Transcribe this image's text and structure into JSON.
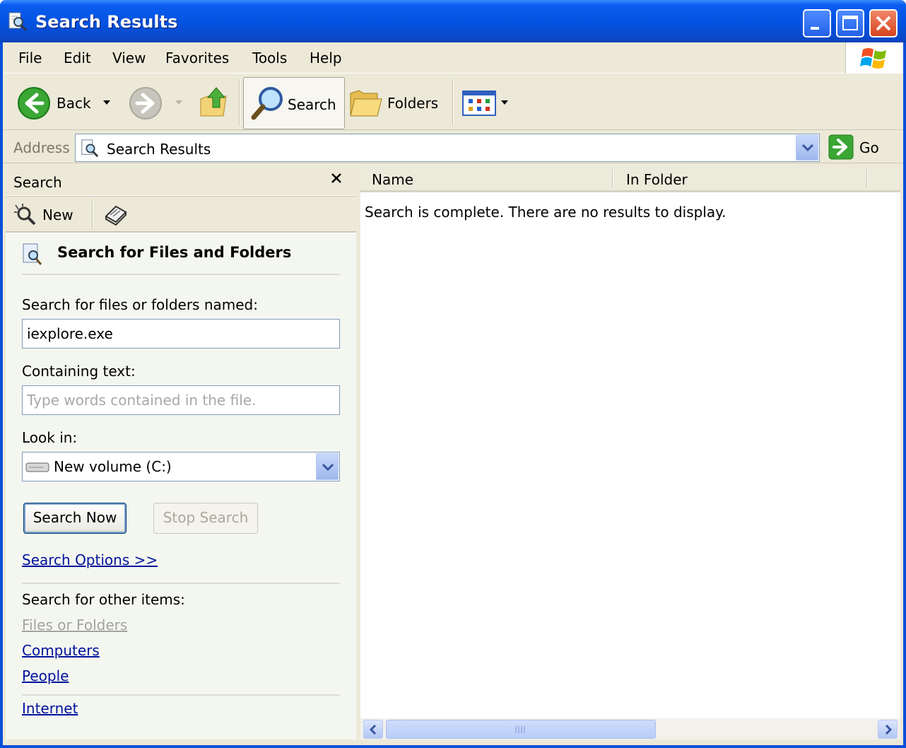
{
  "window": {
    "title": "Search Results"
  },
  "menu": {
    "items": [
      "File",
      "Edit",
      "View",
      "Favorites",
      "Tools",
      "Help"
    ]
  },
  "toolbar": {
    "back": "Back",
    "search": "Search",
    "folders": "Folders"
  },
  "address": {
    "label": "Address",
    "value": "Search Results",
    "go": "Go"
  },
  "left_pane": {
    "title": "Search",
    "new_label": "New",
    "heading": "Search for Files and Folders",
    "named_label": "Search for files or folders named:",
    "named_value": "iexplore.exe",
    "containing_label": "Containing text:",
    "containing_placeholder": "Type words contained in the file.",
    "lookin_label": "Look in:",
    "lookin_value": "New volume (C:)",
    "search_now": "Search Now",
    "stop_search": "Stop Search",
    "search_options": "Search Options >>",
    "other_label": "Search for other items:",
    "other_links": [
      "Files or Folders",
      "Computers",
      "People"
    ],
    "internet": "Internet"
  },
  "results": {
    "columns": [
      "Name",
      "In Folder"
    ],
    "message": "Search is complete. There are no results to display."
  }
}
